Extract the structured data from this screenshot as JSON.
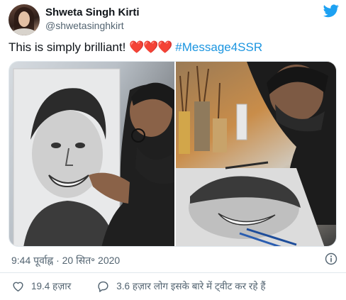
{
  "user": {
    "display_name": "Shweta Singh Kirti",
    "handle": "@shwetasinghkirt"
  },
  "tweet": {
    "text_before": "This is simply brilliant! ",
    "emoji": "❤️❤️❤️",
    "hashtag": "#Message4SSR"
  },
  "media": {
    "count": 2
  },
  "meta": {
    "timestamp": "9:44 पूर्वाह्न · 20 सित॰ 2020"
  },
  "actions": {
    "likes": "19.4 हज़ार",
    "discussion": "3.6 हज़ार लोग इसके बारे में ट्वीट कर रहे हैं"
  },
  "colors": {
    "twitter_blue": "#1da1f2",
    "hashtag": "#1b95e0",
    "heart": "#e0245e",
    "secondary_text": "#536471"
  },
  "icons": {
    "brand": "twitter-bird-icon",
    "info": "info-icon",
    "like": "heart-outline-icon",
    "reply": "speech-bubble-icon"
  }
}
